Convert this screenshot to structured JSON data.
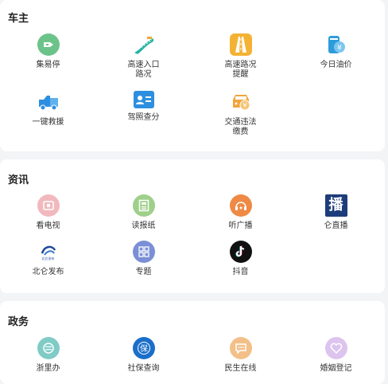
{
  "sections": [
    {
      "title": "车主",
      "items": [
        {
          "label": "集易停",
          "icon": "parking-icon",
          "color": "#6cc38a"
        },
        {
          "label": "高速入口\n路况",
          "icon": "highway-entrance-icon",
          "color": "#2bb3a3"
        },
        {
          "label": "高速路况\n提醒",
          "icon": "highway-road-icon",
          "color": "#f4b234"
        },
        {
          "label": "今日油价",
          "icon": "oil-price-icon",
          "color": "#2e9cdb"
        },
        {
          "label": "一键救援",
          "icon": "rescue-truck-icon",
          "color": "#2e8fe0"
        },
        {
          "label": "驾照查分",
          "icon": "license-card-icon",
          "color": "#2e8fe0"
        },
        {
          "label": "交通违法\n缴费",
          "icon": "traffic-fine-icon",
          "color": "#f2a43c"
        }
      ]
    },
    {
      "title": "资讯",
      "items": [
        {
          "label": "看电视",
          "icon": "tv-icon",
          "color": "#f1b9bd"
        },
        {
          "label": "读报纸",
          "icon": "newspaper-icon",
          "color": "#9fd08a"
        },
        {
          "label": "听广播",
          "icon": "radio-icon",
          "color": "#ee8a45"
        },
        {
          "label": "仑直播",
          "icon": "live-broadcast-icon",
          "color": "#1d3d7a"
        },
        {
          "label": "北仑发布",
          "icon": "beilun-release-icon",
          "color": "#1f4b9a"
        },
        {
          "label": "专题",
          "icon": "topics-icon",
          "color": "#7b8fd6"
        },
        {
          "label": "抖音",
          "icon": "douyin-icon",
          "color": "#111111"
        }
      ]
    },
    {
      "title": "政务",
      "items": [
        {
          "label": "浙里办",
          "icon": "zheliban-icon",
          "color": "#7fcbc6"
        },
        {
          "label": "社保查询",
          "icon": "social-security-icon",
          "color": "#1b6fc9"
        },
        {
          "label": "民生在线",
          "icon": "livelihood-chat-icon",
          "color": "#f3c089"
        },
        {
          "label": "婚姻登记",
          "icon": "marriage-heart-icon",
          "color": "#dcc4ef"
        }
      ]
    }
  ],
  "live_icon_glyph": "播",
  "beilun_icon_text": "北仑发布"
}
